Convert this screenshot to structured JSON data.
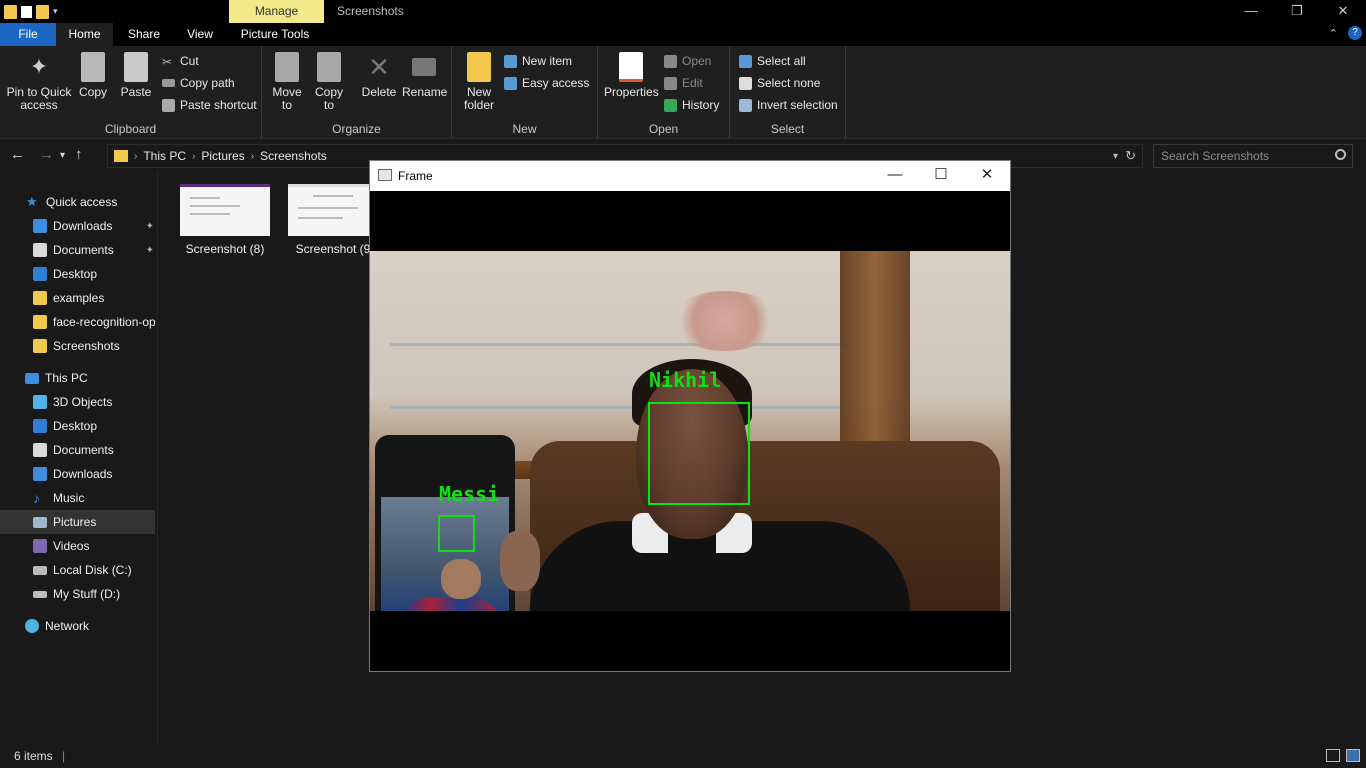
{
  "window": {
    "manage_tab": "Manage",
    "title": "Screenshots",
    "controls": {
      "minimize": "—",
      "restore": "❐",
      "close": "✕"
    }
  },
  "tabs": {
    "file": "File",
    "home": "Home",
    "share": "Share",
    "view": "View",
    "picture_tools": "Picture Tools"
  },
  "ribbon": {
    "clipboard": {
      "label": "Clipboard",
      "pin": "Pin to Quick access",
      "copy": "Copy",
      "paste": "Paste",
      "cut": "Cut",
      "copy_path": "Copy path",
      "paste_shortcut": "Paste shortcut"
    },
    "organize": {
      "label": "Organize",
      "move_to": "Move to",
      "copy_to": "Copy to",
      "delete": "Delete",
      "rename": "Rename"
    },
    "new": {
      "label": "New",
      "new_folder": "New folder",
      "new_item": "New item",
      "easy_access": "Easy access"
    },
    "open": {
      "label": "Open",
      "properties": "Properties",
      "open": "Open",
      "edit": "Edit",
      "history": "History"
    },
    "select": {
      "label": "Select",
      "select_all": "Select all",
      "select_none": "Select none",
      "invert_selection": "Invert selection"
    }
  },
  "address": {
    "crumbs": [
      "This PC",
      "Pictures",
      "Screenshots"
    ],
    "search_placeholder": "Search Screenshots"
  },
  "nav": {
    "quick_access": "Quick access",
    "quick_items": [
      "Downloads",
      "Documents",
      "Desktop",
      "examples",
      "face-recognition-op",
      "Screenshots"
    ],
    "this_pc": "This PC",
    "pc_items": [
      "3D Objects",
      "Desktop",
      "Documents",
      "Downloads",
      "Music",
      "Pictures",
      "Videos",
      "Local Disk (C:)",
      "My Stuff (D:)"
    ],
    "network": "Network"
  },
  "files": [
    {
      "name": "Screenshot (8)"
    },
    {
      "name": "Screenshot (9"
    }
  ],
  "status": {
    "count": "6 items"
  },
  "frame": {
    "title": "Frame",
    "faces": [
      {
        "label": "Nikhil"
      },
      {
        "label": "Messi"
      }
    ]
  },
  "colors": {
    "accent": "#1a66c2",
    "manage_tab": "#f2e98b",
    "face_box": "#10e010"
  }
}
